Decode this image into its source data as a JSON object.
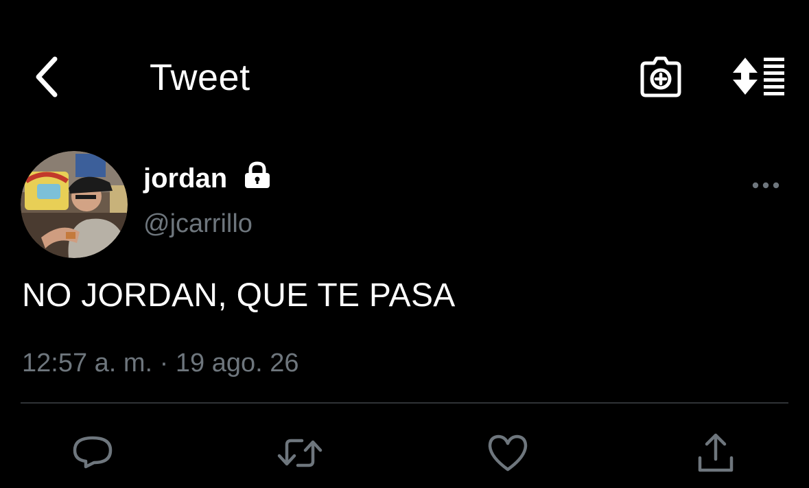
{
  "header": {
    "title": "Tweet",
    "icons": [
      "back-arrow-icon",
      "camera-plus-icon",
      "sort-lines-icon"
    ]
  },
  "tweet": {
    "author": {
      "display_name": "jordan",
      "handle": "@jcarrillo",
      "protected_icon": "lock-icon"
    },
    "text": "NO JORDAN, QUE TE PASA",
    "timestamp": "12:57 a. m. · 19 ago. 26",
    "actions": [
      "reply-icon",
      "retweet-icon",
      "like-icon",
      "share-icon"
    ]
  },
  "colors": {
    "background": "#000000",
    "text": "#ffffff",
    "muted": "#6e767d",
    "divider": "#2f3336"
  }
}
